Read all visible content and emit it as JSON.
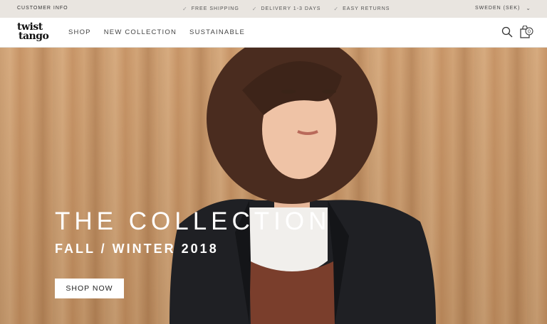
{
  "topbar": {
    "customer_info": "CUSTOMER INFO",
    "usps": [
      "FREE SHIPPING",
      "DELIVERY 1-3 DAYS",
      "EASY RETURNS"
    ],
    "region": "SWEDEN (SEK)"
  },
  "nav": {
    "logo_line1": "twist",
    "logo_line2": "tango",
    "links": [
      "SHOP",
      "NEW COLLECTION",
      "SUSTAINABLE"
    ],
    "cart_count": "0"
  },
  "hero": {
    "title": "THE COLLECTION",
    "subtitle": "FALL / WINTER 2018",
    "cta": "SHOP NOW"
  },
  "colors": {
    "topbar_bg": "#e9e5e0",
    "wood": "#c99a6c",
    "jacket": "#1f2024",
    "hair": "#4a2c1f"
  }
}
